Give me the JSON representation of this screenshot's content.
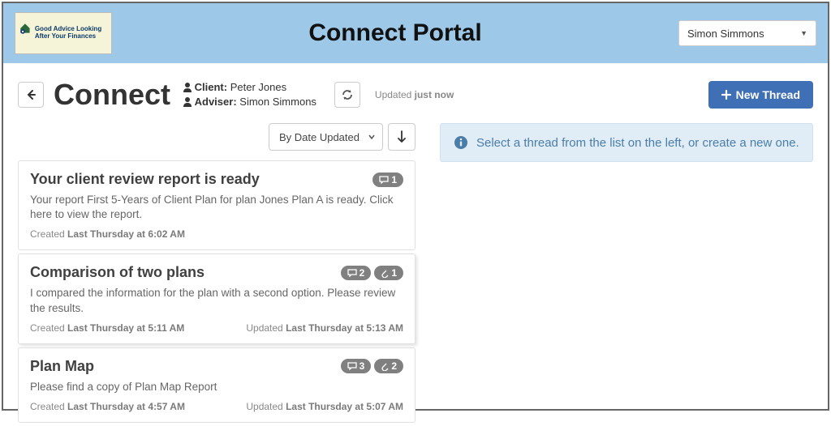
{
  "header": {
    "logo_text": "Good Advice Looking After Your Finances",
    "portal_title": "Connect Portal",
    "user": "Simon Simmons"
  },
  "page": {
    "title": "Connect",
    "client_label": "Client:",
    "client_name": "Peter Jones",
    "adviser_label": "Adviser:",
    "adviser_name": "Simon Simmons",
    "updated_prefix": "Updated",
    "updated_value": "just now",
    "new_thread_label": "New Thread"
  },
  "sort": {
    "label": "By Date Updated"
  },
  "threads": [
    {
      "title": "Your client review report is ready",
      "body": "Your report First 5-Years of Client Plan for plan Jones Plan A is ready. Click here to view the report.",
      "comments": "1",
      "attachments": null,
      "created_prefix": "Created",
      "created_value": "Last Thursday at 6:02 AM",
      "updated_prefix": null,
      "updated_value": null
    },
    {
      "title": "Comparison of two plans",
      "body": "I compared the information for the plan with a second option. Please review the results.",
      "comments": "2",
      "attachments": "1",
      "created_prefix": "Created",
      "created_value": "Last Thursday at 5:11 AM",
      "updated_prefix": "Updated",
      "updated_value": "Last Thursday at 5:13 AM"
    },
    {
      "title": "Plan Map",
      "body": "Please find a copy of Plan Map Report",
      "comments": "3",
      "attachments": "2",
      "created_prefix": "Created",
      "created_value": "Last Thursday at 4:57 AM",
      "updated_prefix": "Updated",
      "updated_value": "Last Thursday at 5:07 AM"
    }
  ],
  "empty_state": {
    "text": "Select a thread from the list on the left, or create a new one."
  }
}
